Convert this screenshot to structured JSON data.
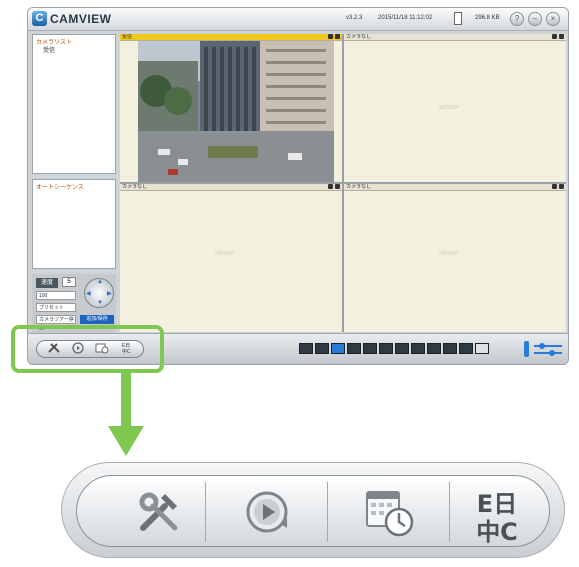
{
  "app": {
    "brand": "CAMVIEW",
    "version": "v3.2.3",
    "datetime": "2015/11/18 11:12:02",
    "speed": "296.8 KB"
  },
  "left_panel": {
    "camera_list_title": "カメラリスト",
    "camera_group": "受信",
    "auto_sequence_title": "オートシーケンス"
  },
  "ptz": {
    "label": "速度",
    "speed_value": "5",
    "field1": "100",
    "preset_select": "プリセット",
    "tour_field": "カメラツアー停止",
    "button_label": "追加/保存"
  },
  "grid": {
    "cells": [
      {
        "title": "受信",
        "active": true
      },
      {
        "title": "カメラなし",
        "active": false
      },
      {
        "title": "カメラなし",
        "active": false
      },
      {
        "title": "カメラなし",
        "active": false
      }
    ],
    "watermark": "viewer"
  },
  "toolbar": {
    "buttons": [
      {
        "name": "settings",
        "icon": "tools-icon"
      },
      {
        "name": "playback",
        "icon": "playback-icon"
      },
      {
        "name": "schedule",
        "icon": "schedule-icon"
      },
      {
        "name": "language",
        "icon": "language-icon",
        "label_top": "E日",
        "label_bottom": "中C"
      }
    ]
  },
  "layout_buttons": [
    "1",
    "4",
    "6",
    "8",
    "9",
    "10",
    "13",
    "16",
    "full",
    "grid",
    "alt",
    "fullscreen"
  ],
  "colors": {
    "highlight": "#7ec850",
    "active_cell": "#f0c818",
    "brand_blue": "#1f63c0"
  }
}
